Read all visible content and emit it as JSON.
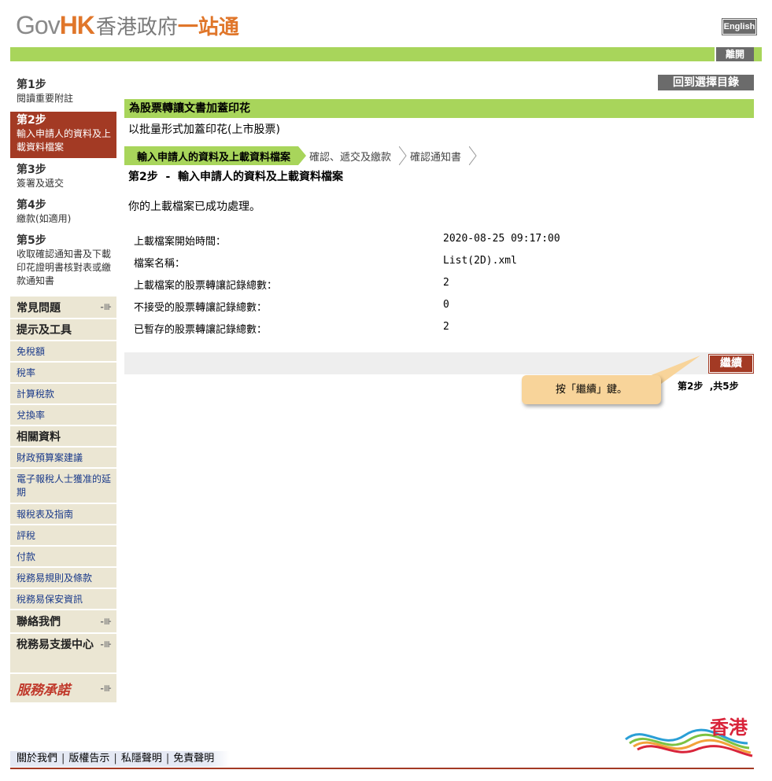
{
  "header": {
    "logo_gov": "Gov",
    "logo_hk": "HK",
    "logo_zh_grey": "香港政府",
    "logo_zh_orange": "一站通",
    "english_label": "English",
    "logout_label": "離開"
  },
  "sidebar": {
    "steps": [
      {
        "title": "第1步",
        "desc": "閱讀重要附註"
      },
      {
        "title": "第2步",
        "desc": "輸入申請人的資料及上載資料檔案"
      },
      {
        "title": "第3步",
        "desc": "簽署及遞交"
      },
      {
        "title": "第4步",
        "desc": "繳款(如適用)"
      },
      {
        "title": "第5步",
        "desc": "收取確認通知書及下載印花證明書核對表或繳款通知書"
      }
    ],
    "faq": "常見問題",
    "tips_header": "提示及工具",
    "tips": [
      "免稅額",
      "稅率",
      "計算稅款",
      "兌換率"
    ],
    "related_header": "相關資料",
    "related": [
      "財政預算案建議",
      "電子報稅人士獲准的延期",
      "報稅表及指南",
      "評稅",
      "付款",
      "稅務易規則及條款",
      "稅務易保安資訊"
    ],
    "contact": "聯絡我們",
    "support": "稅務易支援中心",
    "pledge": "服務承諾"
  },
  "main": {
    "back_label": "回到選擇目錄",
    "title": "為股票轉讓文書加蓋印花",
    "subtitle": "以批量形式加蓋印花(上市股票)",
    "breadcrumbs": [
      "輸入申請人的資料及上載資料檔案",
      "確認、遞交及繳款",
      "確認通知書"
    ],
    "step_title": "第2步  -  輸入申請人的資料及上載資料檔案",
    "message": "你的上載檔案已成功處理。",
    "details": [
      {
        "label": "上載檔案開始時間：",
        "value": "2020-08-25 09:17:00"
      },
      {
        "label": "檔案名稱：",
        "value": "List(2D).xml"
      },
      {
        "label": "上載檔案的股票轉讓記錄總數：",
        "value": "2"
      },
      {
        "label": "不接受的股票轉讓記錄總數：",
        "value": "0"
      },
      {
        "label": "已暫存的股票轉讓記錄總數：",
        "value": "2"
      }
    ],
    "continue_label": "繼續",
    "step_count": "第2步  ,共5步",
    "tooltip": "按「繼續」鍵。"
  },
  "footer": {
    "links": [
      "關於我們",
      "版權告示",
      "私隱聲明",
      "免責聲明"
    ],
    "brand": "香港"
  },
  "colors": {
    "green": "#a8d55b",
    "maroon": "#a33a24",
    "grey_button": "#6b6b6b",
    "sidebar_bg": "#ebe6d3",
    "tooltip_bg": "#f8d49a"
  }
}
